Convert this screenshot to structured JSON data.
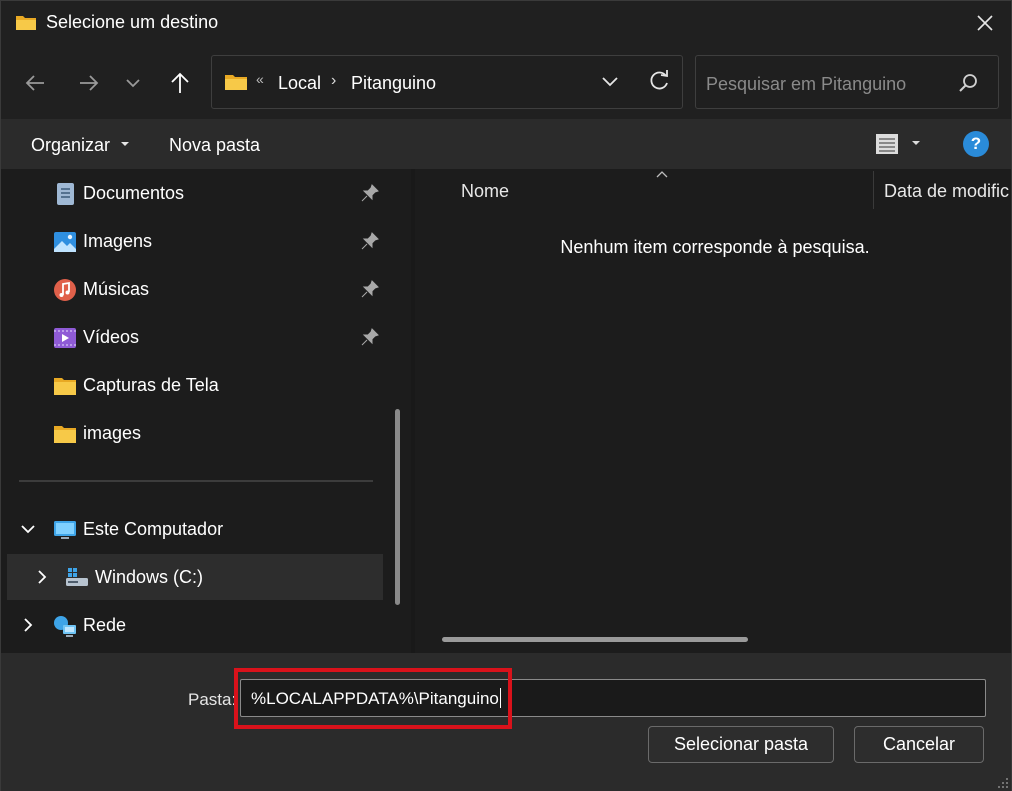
{
  "window": {
    "title": "Selecione um destino"
  },
  "address": {
    "chevrons": "«",
    "crumbs": [
      "Local",
      "Pitanguino"
    ],
    "separator": "›"
  },
  "search": {
    "placeholder": "Pesquisar em Pitanguino"
  },
  "toolbar": {
    "organize_label": "Organizar",
    "new_folder_label": "Nova pasta",
    "help_label": "?"
  },
  "sidebar": {
    "items": [
      {
        "label": "Documentos",
        "icon": "document-icon",
        "pinned": true
      },
      {
        "label": "Imagens",
        "icon": "pictures-icon",
        "pinned": true
      },
      {
        "label": "Músicas",
        "icon": "music-icon",
        "pinned": true
      },
      {
        "label": "Vídeos",
        "icon": "videos-icon",
        "pinned": true
      },
      {
        "label": "Capturas de Tela",
        "icon": "folder-icon",
        "pinned": false
      },
      {
        "label": "images",
        "icon": "folder-icon",
        "pinned": false
      },
      {
        "label": "Este Computador",
        "icon": "computer-icon",
        "expanded": true
      },
      {
        "label": "Windows (C:)",
        "icon": "drive-icon",
        "expanded": false,
        "selected": true
      },
      {
        "label": "Rede",
        "icon": "network-icon",
        "expanded": false
      }
    ]
  },
  "content": {
    "columns": [
      "Nome",
      "Data de modific"
    ],
    "empty_message": "Nenhum item corresponde à pesquisa."
  },
  "footer": {
    "folder_label": "Pasta:",
    "folder_value": "%LOCALAPPDATA%\\Pitanguino",
    "select_button": "Selecionar pasta",
    "cancel_button": "Cancelar"
  },
  "colors": {
    "highlight": "#d9121b",
    "accent": "#2a8bd9",
    "folder": "#f5c542"
  }
}
